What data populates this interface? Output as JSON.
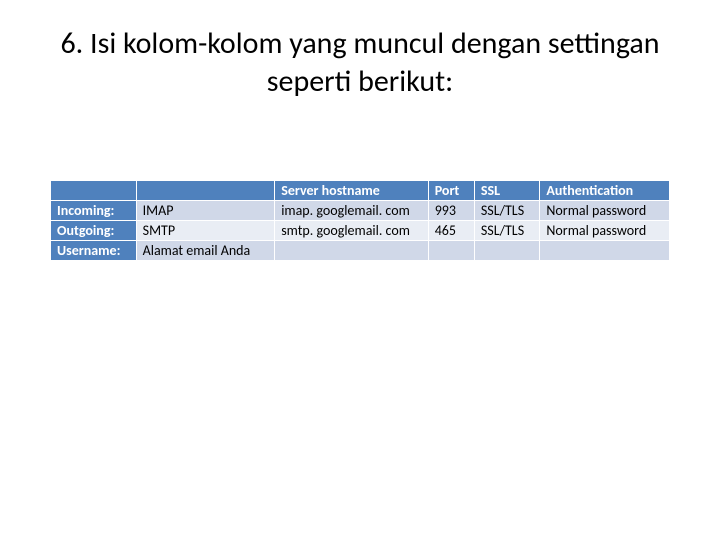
{
  "title": "6. Isi kolom-kolom yang muncul dengan settingan seperti berikut:",
  "headers": {
    "server_hostname": "Server hostname",
    "port": "Port",
    "ssl": "SSL",
    "auth": "Authentication"
  },
  "rows": {
    "incoming": {
      "label": "Incoming:",
      "protocol": "IMAP",
      "hostname": "imap. googlemail. com",
      "port": "993",
      "ssl": "SSL/TLS",
      "auth": "Normal password"
    },
    "outgoing": {
      "label": "Outgoing:",
      "protocol": "SMTP",
      "hostname": "smtp. googlemail. com",
      "port": "465",
      "ssl": "SSL/TLS",
      "auth": "Normal password"
    },
    "username": {
      "label": "Username:",
      "value": "Alamat email Anda"
    }
  }
}
